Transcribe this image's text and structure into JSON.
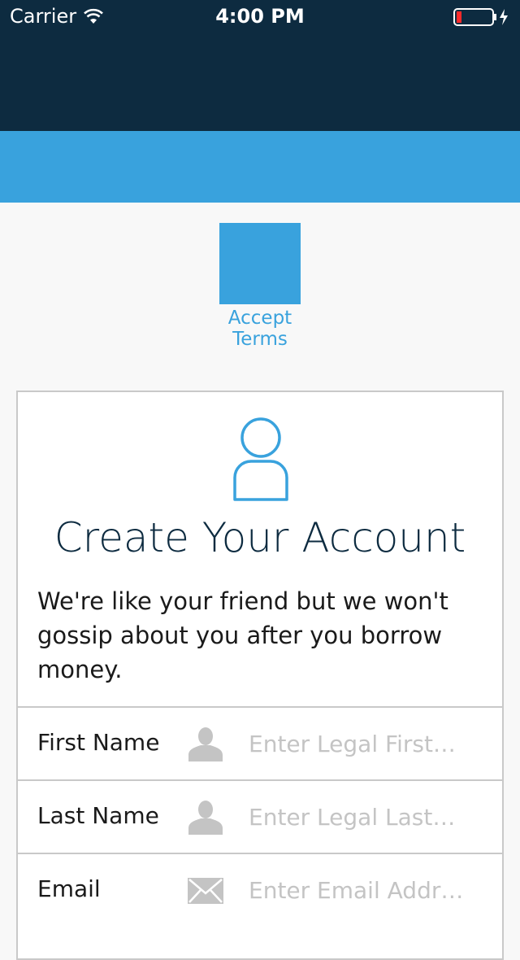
{
  "status_bar": {
    "carrier": "Carrier",
    "time": "4:00 PM"
  },
  "accept_terms": {
    "label": "Accept Terms",
    "color": "#39a2dd"
  },
  "card": {
    "icon": "user-avatar-icon",
    "title": "Create Your Account",
    "subtitle": "We're like your friend but we won't gossip about you after you borrow money."
  },
  "form": {
    "fields": [
      {
        "label": "First Name",
        "icon": "person-icon",
        "placeholder": "Enter Legal First…",
        "value": ""
      },
      {
        "label": "Last Name",
        "icon": "person-icon",
        "placeholder": "Enter Legal Last…",
        "value": ""
      },
      {
        "label": "Email",
        "icon": "envelope-icon",
        "placeholder": "Enter Email Addr…",
        "value": ""
      }
    ]
  },
  "colors": {
    "navy": "#0d2b40",
    "accent_blue": "#39a2dd",
    "background": "#f8f8f8",
    "border": "#c9c9c9",
    "placeholder": "#c4c4c4"
  }
}
